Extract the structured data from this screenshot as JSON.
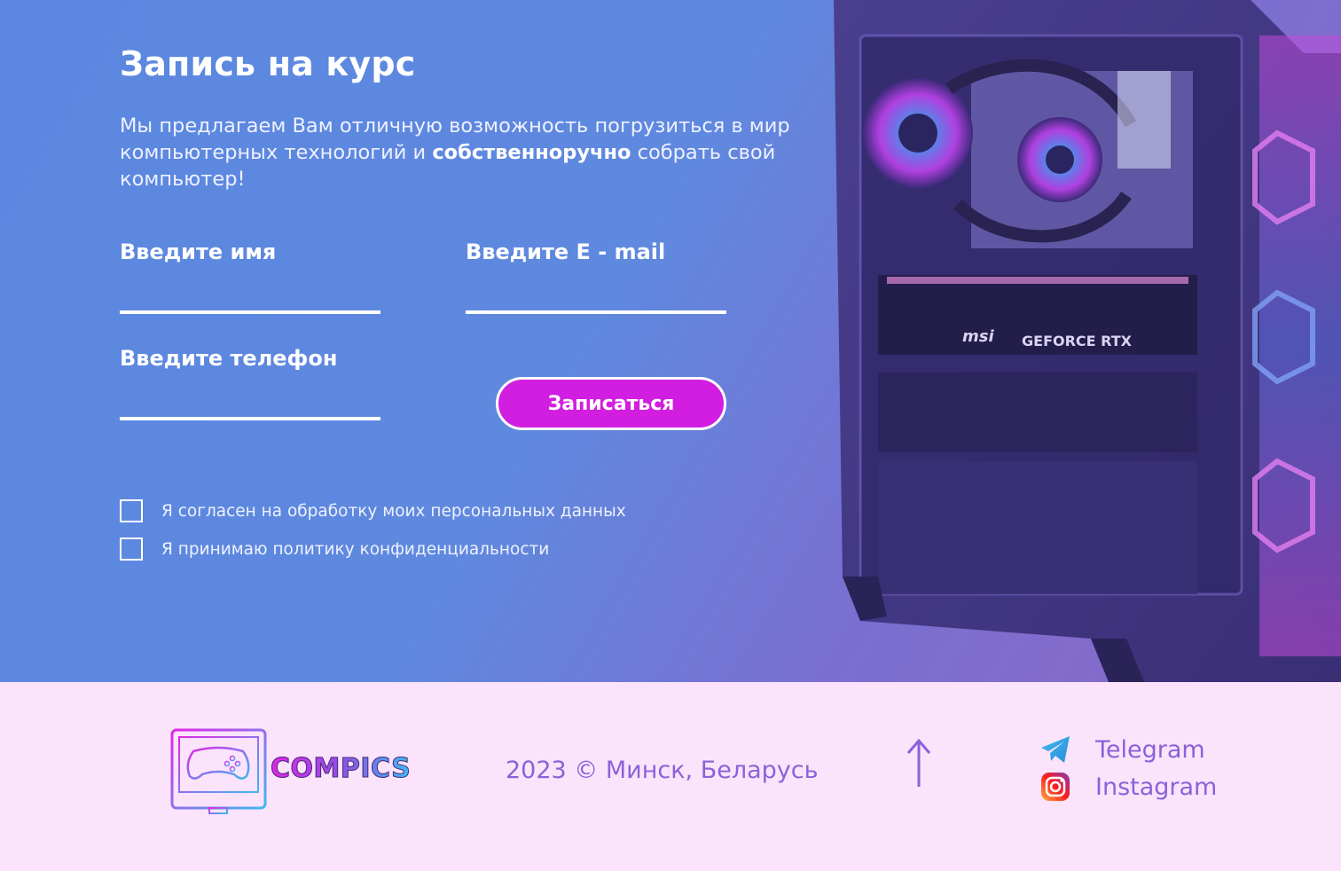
{
  "hero": {
    "title": "Запись на курс",
    "lead_part1": "Мы предлагаем Вам отличную возможность погрузиться в мир компьютерных технологий и ",
    "lead_bold": "собственноручно",
    "lead_part2": " собрать свой компьютер!",
    "artwork": {
      "brand": "msi",
      "gpu_label": "GEFORCE RTX"
    }
  },
  "form": {
    "name_label": "Введите имя",
    "email_label": "Введите E - mail",
    "phone_label": "Введите телефон",
    "name_value": "",
    "email_value": "",
    "phone_value": "",
    "submit_label": "Записаться",
    "checkboxes": [
      {
        "label": "Я согласен на обработку моих персональных данных",
        "checked": false
      },
      {
        "label": "Я принимаю политику конфиденциальности",
        "checked": false
      }
    ]
  },
  "footer": {
    "logo_text": "COMPICS",
    "copyright": "2023 © Минск, Беларусь",
    "scroll_top_icon": "arrow-up-icon",
    "socials": [
      {
        "name": "Telegram",
        "icon": "telegram-icon"
      },
      {
        "name": "Instagram",
        "icon": "instagram-icon"
      }
    ]
  },
  "colors": {
    "accent": "#d21ee0",
    "footer_text": "#8b62d8",
    "footer_bg": "#fbe3fb",
    "hero_blue": "#5b87e0",
    "hero_purple": "#8b68c6"
  }
}
